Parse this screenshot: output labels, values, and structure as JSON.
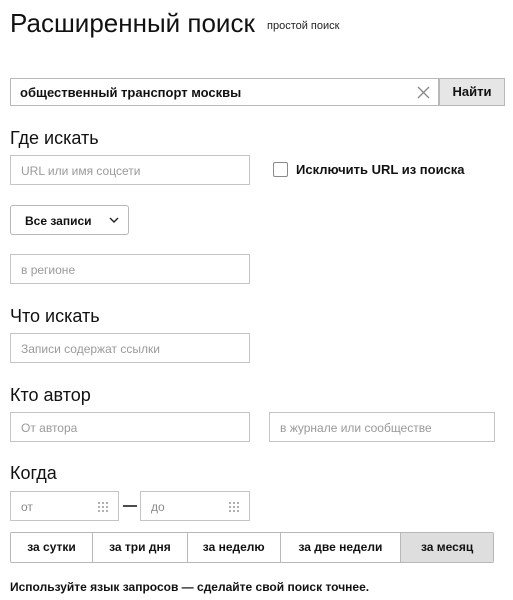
{
  "page": {
    "title": "Расширенный поиск",
    "simple_search_link": "простой поиск"
  },
  "search": {
    "query": "общественный транспорт москвы",
    "submit_label": "Найти"
  },
  "where": {
    "heading": "Где искать",
    "url_placeholder": "URL или имя соцсети",
    "exclude_url_label": "Исключить URL из поиска",
    "exclude_url_checked": false,
    "scope_selected": "Все записи",
    "region_placeholder": "в регионе"
  },
  "what": {
    "heading": "Что искать",
    "links_placeholder": "Записи содержат ссылки"
  },
  "who": {
    "heading": "Кто автор",
    "author_placeholder": "От автора",
    "community_placeholder": "в журнале или сообществе"
  },
  "when": {
    "heading": "Когда",
    "from_placeholder": "от",
    "to_placeholder": "до",
    "periods": [
      "за сутки",
      "за три дня",
      "за неделю",
      "за две недели",
      "за месяц"
    ],
    "active_period": "за месяц"
  },
  "footer": {
    "note": "Используйте язык запросов — сделайте свой поиск точнее."
  },
  "icons": {
    "clear": "close-icon",
    "dropdown": "chevron-down-icon",
    "date_picker": "calendar-icon"
  }
}
